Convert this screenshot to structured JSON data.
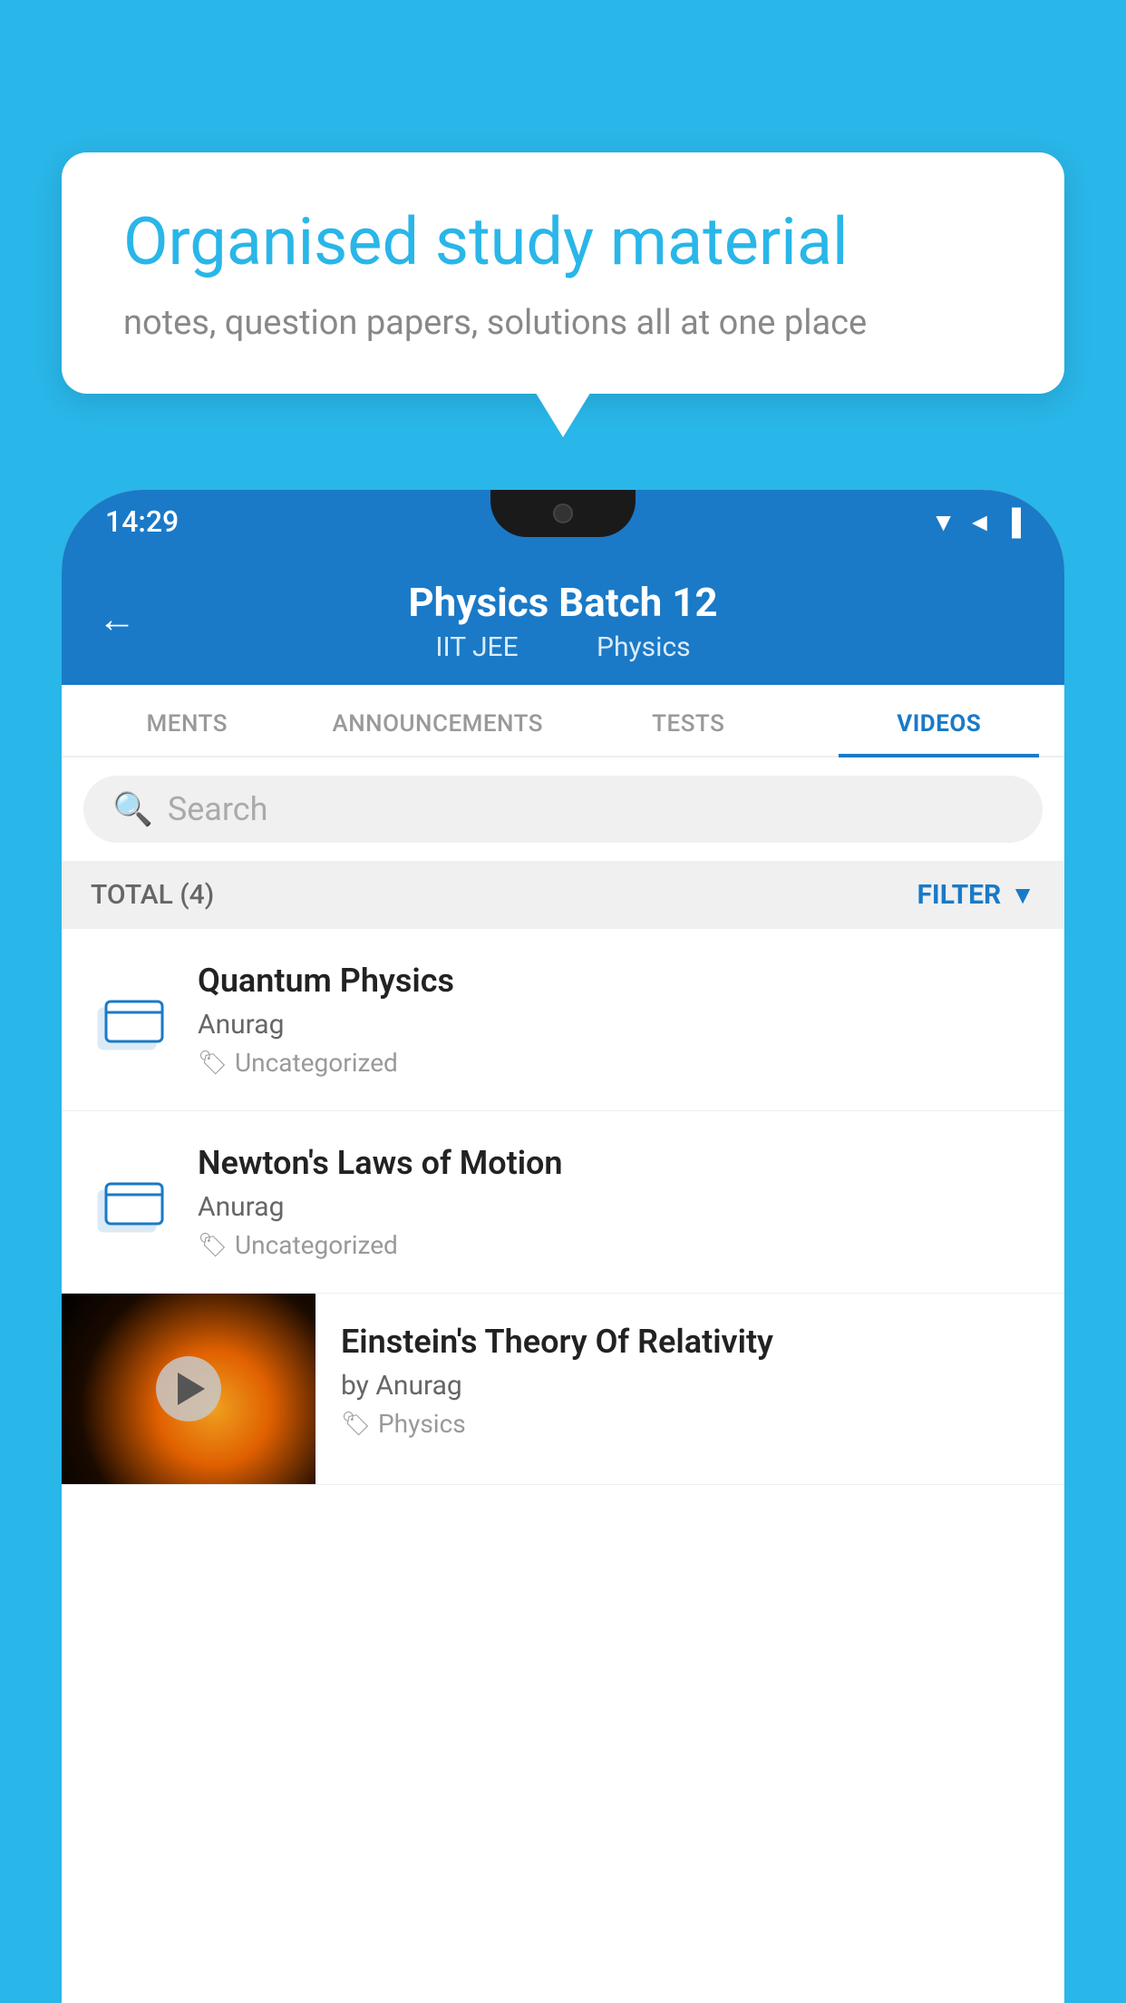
{
  "background_color": "#29b6e8",
  "bubble": {
    "title": "Organised study material",
    "subtitle": "notes, question papers, solutions all at one place"
  },
  "status_bar": {
    "time": "14:29",
    "signal_icon": "▼◄▐"
  },
  "header": {
    "back_label": "←",
    "title": "Physics Batch 12",
    "subtitle_part1": "IIT JEE",
    "subtitle_part2": "Physics"
  },
  "tabs": [
    {
      "label": "MENTS",
      "active": false
    },
    {
      "label": "ANNOUNCEMENTS",
      "active": false
    },
    {
      "label": "TESTS",
      "active": false
    },
    {
      "label": "VIDEOS",
      "active": true
    }
  ],
  "search": {
    "placeholder": "Search"
  },
  "filter_bar": {
    "total_label": "TOTAL (4)",
    "filter_label": "FILTER"
  },
  "list_items": [
    {
      "title": "Quantum Physics",
      "author": "Anurag",
      "tag": "Uncategorized",
      "has_thumbnail": false
    },
    {
      "title": "Newton's Laws of Motion",
      "author": "Anurag",
      "tag": "Uncategorized",
      "has_thumbnail": false
    },
    {
      "title": "Einstein's Theory Of Relativity",
      "author": "by Anurag",
      "tag": "Physics",
      "has_thumbnail": true
    }
  ]
}
